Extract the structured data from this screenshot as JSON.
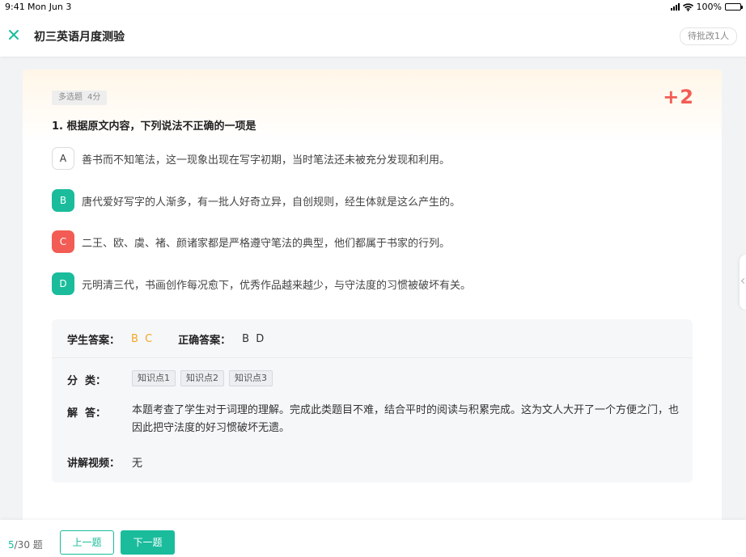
{
  "status_bar": {
    "time": "9:41",
    "date": "Mon Jun 3",
    "battery": "100%",
    "battery_level": 1.0
  },
  "header": {
    "title": "初三英语月度测验",
    "pending_badge": "待批改1人",
    "close_icon": "close-icon"
  },
  "question": {
    "type": "多选题",
    "points": "4分",
    "score_mark": "+2",
    "text": "1. 根据原文内容，下列说法不正确的一项是",
    "options": [
      {
        "letter": "A",
        "text": "善书而不知笔法，这一现象出现在写字初期，当时笔法还未被充分发现和利用。",
        "state": "neutral"
      },
      {
        "letter": "B",
        "text": "唐代爱好写字的人渐多，有一批人好奇立异，自创规则，经生体就是这么产生的。",
        "state": "correct"
      },
      {
        "letter": "C",
        "text": "二王、欧、虞、褚、颜诸家都是严格遵守笔法的典型，他们都属于书家的行列。",
        "state": "wrong"
      },
      {
        "letter": "D",
        "text": "元明清三代，书画创作每况愈下，优秀作品越来越少，与守法度的习惯被破坏有关。",
        "state": "correct"
      }
    ]
  },
  "analysis": {
    "student_answer_label": "学生答案：",
    "student_answer": "B C",
    "correct_answer_label": "正确答案：",
    "correct_answer": "B D",
    "category_label": "分  类：",
    "tags": [
      "知识点1",
      "知识点2",
      "知识点3"
    ],
    "explanation_label": "解  答：",
    "explanation": "本题考查了学生对于词理的理解。完成此类题目不难，结合平时的阅读与积累完成。这为文人大开了一个方便之门，也因此把守法度的好习惯破坏无遗。",
    "video_label": "讲解视频：",
    "video_value": "无"
  },
  "footer": {
    "current": "5",
    "total": "/30 题",
    "prev_label": "上一题",
    "next_label": "下一题"
  },
  "colors": {
    "accent": "#1abc9c",
    "wrong": "#f25c54",
    "student_answer": "#f5a623"
  }
}
